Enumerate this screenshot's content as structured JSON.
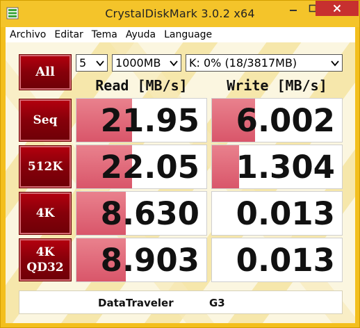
{
  "window": {
    "title": "CrystalDiskMark 3.0.2 x64"
  },
  "menu": [
    "Archivo",
    "Editar",
    "Tema",
    "Ayuda",
    "Language"
  ],
  "controls": {
    "all_label": "All",
    "test_count": "5",
    "test_size": "1000MB",
    "drive": "K: 0% (18/3817MB)"
  },
  "headers": {
    "read": "Read [MB/s]",
    "write": "Write [MB/s]"
  },
  "tests": [
    {
      "label": "Seq",
      "read": "21.95",
      "write": "6.002",
      "read_fill": 0.43,
      "write_fill": 0.33
    },
    {
      "label": "512K",
      "read": "22.05",
      "write": "1.304",
      "read_fill": 0.43,
      "write_fill": 0.21
    },
    {
      "label": "4K",
      "read": "8.630",
      "write": "0.013",
      "read_fill": 0.38,
      "write_fill": 0.0
    },
    {
      "label": "4K\nQD32",
      "read": "8.903",
      "write": "0.013",
      "read_fill": 0.38,
      "write_fill": 0.0
    }
  ],
  "status": {
    "device_name": "DataTraveler",
    "device_model": "G3"
  },
  "colors": {
    "frame": "#f3bf1d",
    "button_red": "#8a000b",
    "bar_pink": "#de6476",
    "close_red": "#c7302f"
  }
}
